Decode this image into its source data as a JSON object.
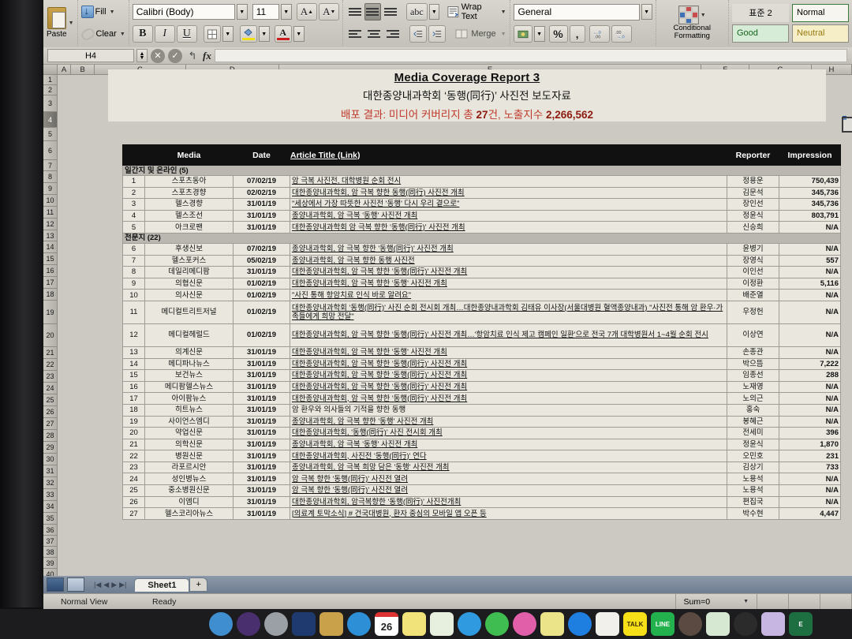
{
  "app": {
    "name": "Microsoft Excel",
    "name_box": "H4",
    "formula_value": ""
  },
  "ribbon": {
    "clipboard": {
      "paste": "Paste"
    },
    "fill": "Fill",
    "clear": "Clear",
    "font": {
      "name": "Calibri (Body)",
      "size": "11",
      "grow": "A",
      "shrink": "A",
      "bold": "B",
      "italic": "I",
      "underline": "U"
    },
    "alignment": {
      "wrap_text": "Wrap Text",
      "merge": "Merge",
      "orientation": "abc"
    },
    "number": {
      "format": "General",
      "percent": "%",
      "comma": ",",
      "inc_dec": ".00",
      "dec_dec": ".00"
    },
    "styles": {
      "conditional_formatting": "Conditional Formatting",
      "cell_style_1": "표준 2",
      "normal": "Normal",
      "good": "Good",
      "neutral": "Neutral"
    }
  },
  "grid": {
    "columns": [
      "A",
      "B",
      "C",
      "D",
      "E",
      "F",
      "G",
      "H"
    ],
    "rows": [
      1,
      2,
      3,
      4,
      5,
      6,
      7,
      8,
      9,
      10,
      11,
      12,
      13,
      14,
      15,
      16,
      17,
      18,
      19,
      20,
      21,
      22,
      23,
      24,
      25,
      26,
      27,
      28,
      29,
      30,
      31,
      32,
      33,
      34,
      35,
      36,
      37,
      38,
      39,
      40
    ],
    "selected_row": 4,
    "selected_cell": "H4"
  },
  "report": {
    "title": "Media Coverage Report 3",
    "subtitle": "대한종양내과학회 ‘동행(同行)’ 사진전 보도자료",
    "result_prefix": "배포 결과: 미디어 커버리지 총 ",
    "result_count": "27",
    "result_mid": "건, 노출지수 ",
    "result_impressions": "2,266,562",
    "accent_color": "#c0392b",
    "link_color": "#1d3f8f",
    "headers": [
      "",
      "Media",
      "Date",
      "Article Title (Link)",
      "Reporter",
      "Impression"
    ],
    "groups": [
      {
        "label": "일간지 및 온라인 (5)"
      },
      {
        "label": "전문지 (22)"
      }
    ],
    "rows": [
      {
        "group": "일간지 및 온라인 (5)"
      },
      {
        "no": "1",
        "media": "스포츠동아",
        "date": "07/02/19",
        "title": "암 극복 사진전, 대학병원 순회 전시",
        "reporter": "정용운",
        "impression": "750,439",
        "link": true
      },
      {
        "no": "2",
        "media": "스포츠경향",
        "date": "02/02/19",
        "title": "대한종양내과학회, 암 극복 향한 동행(同行) 사진전 개최",
        "reporter": "김문석",
        "impression": "345,736",
        "link": true
      },
      {
        "no": "3",
        "media": "헬스경향",
        "date": "31/01/19",
        "title": "\"세상에서 가장 따뜻한 사진전 '동행' 다시 우리 곁으로\"",
        "reporter": "장인선",
        "impression": "345,736",
        "link": true
      },
      {
        "no": "4",
        "media": "헬스조선",
        "date": "31/01/19",
        "title": "종양내과학회, 암 극복 '동행' 사진전 개최",
        "reporter": "정윤식",
        "impression": "803,791",
        "link": true
      },
      {
        "no": "5",
        "media": "아크로팬",
        "date": "31/01/19",
        "title": "대한종양내과학회 암 극복 향한 '동행(同行)' 사진전 개최",
        "reporter": "신승희",
        "impression": "N/A",
        "link": true
      },
      {
        "group": "전문지 (22)"
      },
      {
        "no": "6",
        "media": "후생신보",
        "date": "07/02/19",
        "title": "종양내과학회, 암 극복 향한 '동행(同行)' 사진전 개최",
        "reporter": "윤병기",
        "impression": "N/A",
        "link": true
      },
      {
        "no": "7",
        "media": "헬스포커스",
        "date": "05/02/19",
        "title": "종양내과학회, 암 극복 향한 동행 사진전",
        "reporter": "장영식",
        "impression": "557",
        "link": true
      },
      {
        "no": "8",
        "media": "데일리메디팜",
        "date": "31/01/19",
        "title": "대한종양내과학회, 암 극복 향한 '동행(同行)' 사진전 개최",
        "reporter": "이인선",
        "impression": "N/A",
        "link": true
      },
      {
        "no": "9",
        "media": "의협신문",
        "date": "01/02/19",
        "title": "대한종양내과학회, 암 극복 향한 '동행' 사진전 개최",
        "reporter": "이정환",
        "impression": "5,116",
        "link": true
      },
      {
        "no": "10",
        "media": "의사신문",
        "date": "01/02/19",
        "title": "\"사진 통해 항암치료 인식 바로 알려요\"",
        "reporter": "배준열",
        "impression": "N/A",
        "link": true
      },
      {
        "no": "11",
        "media": "메디컬트리트저널",
        "date": "01/02/19",
        "title": "대한종양내과학회 '동행(同行)' 사진 순회 전시회 개최…대한종양내과학회 김태유 이사장(서울대병원 혈액종양내과) \"사진전 통해 암 환우·가족들에게 희망 전달\"",
        "reporter": "우정헌",
        "impression": "N/A",
        "link": true,
        "tall": true
      },
      {
        "no": "12",
        "media": "메디컬헤럴드",
        "date": "01/02/19",
        "title": "대한종양내과학회, 암 극복 향한 '동행(同行)' 사진전 개최…'항암치료 인식 제고 캠페인 일환'으로 전국 7개 대학병원서 1~4월 순회 전시",
        "reporter": "이상연",
        "impression": "N/A",
        "link": true,
        "tall": true
      },
      {
        "no": "13",
        "media": "의계신문",
        "date": "31/01/19",
        "title": "대한종양내과학회, 암 극복 향한 '동행' 사진전 개최",
        "reporter": "손종관",
        "impression": "N/A",
        "link": true
      },
      {
        "no": "14",
        "media": "메디파나뉴스",
        "date": "31/01/19",
        "title": "대한종양내과학회, 암 극복 향한 '동행(同行)' 사진전 개최",
        "reporter": "박으뜸",
        "impression": "7,222",
        "link": true
      },
      {
        "no": "15",
        "media": "보건뉴스",
        "date": "31/01/19",
        "title": "대한종양내과학회, 암 극복 향한 '동행(同行)' 사진전 개최",
        "reporter": "임종선",
        "impression": "288",
        "link": true
      },
      {
        "no": "16",
        "media": "메디팜헬스뉴스",
        "date": "31/01/19",
        "title": "대한종양내과학회, 암 극복 향한 '동행(同行)' 사진전 개최",
        "reporter": "노재영",
        "impression": "N/A",
        "link": true
      },
      {
        "no": "17",
        "media": "아이팜뉴스",
        "date": "31/01/19",
        "title": "대한종양내과학회, 암 극복 향한 '동행(同行)' 사진전 개최",
        "reporter": "노의근",
        "impression": "N/A",
        "link": true
      },
      {
        "no": "18",
        "media": "히트뉴스",
        "date": "31/01/19",
        "title": "암 환우와 의사들의 기적을 향한 동행",
        "reporter": "홍숙",
        "impression": "N/A",
        "link": false
      },
      {
        "no": "19",
        "media": "사이언스엠디",
        "date": "31/01/19",
        "title": "종양내과학회, 암 극복 향한 '동행' 사진전 개최",
        "reporter": "봉혜근",
        "impression": "N/A",
        "link": true
      },
      {
        "no": "20",
        "media": "약업신문",
        "date": "31/01/19",
        "title": "대한종양내과학회, '동행(同行)' 사진 전시회 개최",
        "reporter": "전세미",
        "impression": "396",
        "link": true
      },
      {
        "no": "21",
        "media": "의학신문",
        "date": "31/01/19",
        "title": "종양내과학회, 암 극복 '동행' 사진전 개최",
        "reporter": "정윤식",
        "impression": "1,870",
        "link": true
      },
      {
        "no": "22",
        "media": "병원신문",
        "date": "31/01/19",
        "title": "대한종양내과학회, 사진전 '동행(同行)' 연다",
        "reporter": "오민호",
        "impression": "231",
        "link": true
      },
      {
        "no": "23",
        "media": "라포르시안",
        "date": "31/01/19",
        "title": "종양내과학회, 암 극복 희망 담은 '동행' 사진전 개최",
        "reporter": "김상기",
        "impression": "733",
        "link": true
      },
      {
        "no": "24",
        "media": "성인병뉴스",
        "date": "31/01/19",
        "title": "암 극복 향한 '동행(同行)' 사진전 열려",
        "reporter": "노용석",
        "impression": "N/A",
        "link": true
      },
      {
        "no": "25",
        "media": "중소병원신문",
        "date": "31/01/19",
        "title": "암 극복 향한 '동행(同行)' 사진전 열려",
        "reporter": "노용석",
        "impression": "N/A",
        "link": true
      },
      {
        "no": "26",
        "media": "이엠디",
        "date": "31/01/19",
        "title": "대한종양내과학회, 암극복향한 '동행(同行)' 사진전개최",
        "reporter": "편집국",
        "impression": "N/A",
        "link": true
      },
      {
        "no": "27",
        "media": "헬스코리아뉴스",
        "date": "31/01/19",
        "title": "[의료계 토막소식] # 건국대병원, 환자 중심의 모바일 앱 오픈 등",
        "reporter": "박수현",
        "impression": "4,447",
        "link": true
      }
    ]
  },
  "bottom": {
    "sheet_tab": "Sheet1",
    "add_sheet": "+",
    "view_mode": "Normal View",
    "status": "Ready",
    "sum": "Sum=0"
  },
  "dock": {
    "items": [
      {
        "name": "finder-icon",
        "label": "",
        "color": "#3f8fd0"
      },
      {
        "name": "launchpad-icon",
        "label": "",
        "color": "#4a2f6e"
      },
      {
        "name": "rocket-icon",
        "label": "",
        "color": "#9aa0a6"
      },
      {
        "name": "photos-icon",
        "label": "",
        "color": "#1f3a6e"
      },
      {
        "name": "folder-icon",
        "label": "",
        "color": "#c9a14a"
      },
      {
        "name": "safari-icon",
        "label": "",
        "color": "#2d8fd5"
      },
      {
        "name": "calendar-icon",
        "label": "26",
        "color": "#ffffff"
      },
      {
        "name": "notes-icon",
        "label": "",
        "color": "#f2e27a"
      },
      {
        "name": "maps-icon",
        "label": "",
        "color": "#e7efdf"
      },
      {
        "name": "messages-icon",
        "label": "",
        "color": "#2f9ae0"
      },
      {
        "name": "phone-icon",
        "label": "",
        "color": "#3fbd51"
      },
      {
        "name": "itunes-icon",
        "label": "",
        "color": "#e05fa8"
      },
      {
        "name": "stickies-icon",
        "label": "",
        "color": "#ece489"
      },
      {
        "name": "app-store-icon",
        "label": "",
        "color": "#1f7fe0"
      },
      {
        "name": "pages-icon",
        "label": "",
        "color": "#f2f0ea"
      },
      {
        "name": "kakaotalk-icon",
        "label": "TALK",
        "color": "#f7e017"
      },
      {
        "name": "line-icon",
        "label": "LINE",
        "color": "#22b14c"
      },
      {
        "name": "chrome-icon",
        "label": "",
        "color": "#5a4a42"
      },
      {
        "name": "spotify-icon",
        "label": "",
        "color": "#d7e8d2"
      },
      {
        "name": "compass-icon",
        "label": "",
        "color": "#2b2b2b"
      },
      {
        "name": "final-cut-icon",
        "label": "",
        "color": "#c8b6e2"
      },
      {
        "name": "excel-icon",
        "label": "E",
        "color": "#1d6f42"
      }
    ]
  }
}
